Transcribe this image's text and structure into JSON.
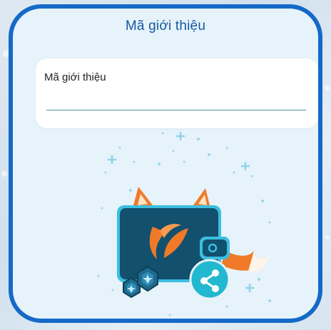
{
  "card": {
    "title": "Mã giới thiệu"
  },
  "referral_field": {
    "label": "Mã giới thiệu",
    "value": "",
    "placeholder": ""
  },
  "colors": {
    "border": "#1569c7",
    "card_bg": "#e6f3fb",
    "title": "#16589e",
    "wallet": "#12506e",
    "accent_cyan": "#22b8cf",
    "fox_orange": "#f07a28"
  },
  "icons": {
    "share": "share-icon",
    "wallet": "wallet-illustration",
    "gems": "gem-icon"
  }
}
